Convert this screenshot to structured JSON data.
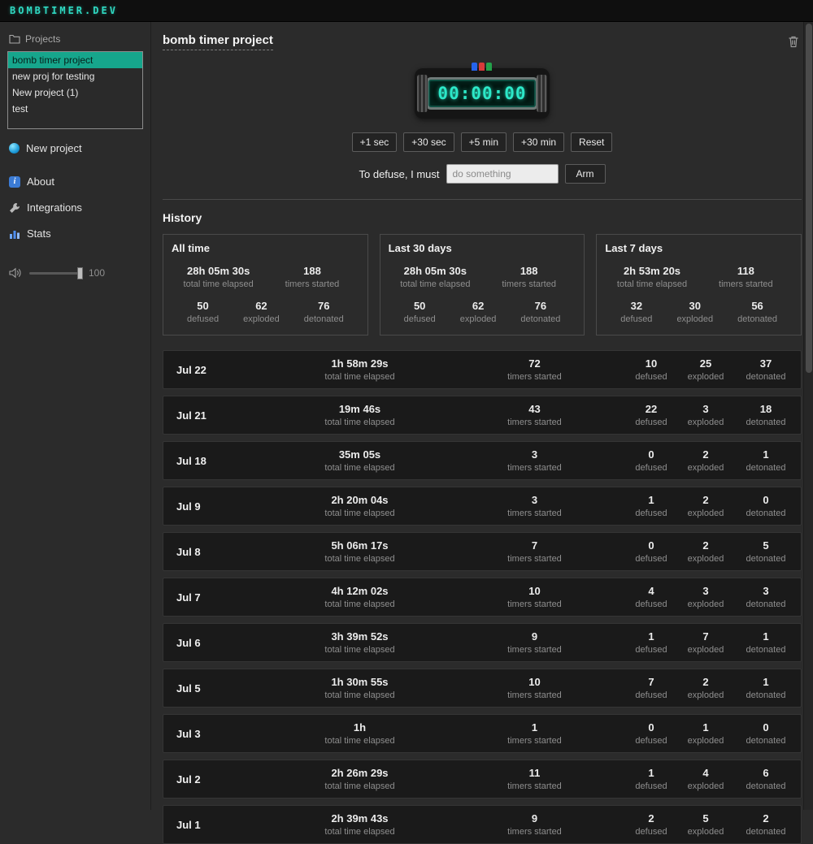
{
  "topbar": {
    "logo": "BOMBTIMER.DEV"
  },
  "sidebar": {
    "projects_label": "Projects",
    "projects": [
      {
        "name": "bomb timer project",
        "selected": true
      },
      {
        "name": "new proj for testing",
        "selected": false
      },
      {
        "name": "New project (1)",
        "selected": false
      },
      {
        "name": "test",
        "selected": false
      }
    ],
    "new_project_label": "New project",
    "about_label": "About",
    "integrations_label": "Integrations",
    "stats_label": "Stats",
    "volume_value": "100"
  },
  "main": {
    "title": "bomb timer project",
    "timer_display": "00:00:00",
    "time_buttons": [
      "+1 sec",
      "+30 sec",
      "+5 min",
      "+30 min",
      "Reset"
    ],
    "defuse_label": "To defuse, I must",
    "defuse_placeholder": "do something",
    "arm_label": "Arm",
    "history_heading": "History"
  },
  "labels": {
    "total_time_elapsed": "total time elapsed",
    "timers_started": "timers started",
    "defused": "defused",
    "exploded": "exploded",
    "detonated": "detonated"
  },
  "summaries": [
    {
      "title": "All time",
      "elapsed": "28h 05m 30s",
      "started": "188",
      "defused": "50",
      "exploded": "62",
      "detonated": "76"
    },
    {
      "title": "Last 30 days",
      "elapsed": "28h 05m 30s",
      "started": "188",
      "defused": "50",
      "exploded": "62",
      "detonated": "76"
    },
    {
      "title": "Last 7 days",
      "elapsed": "2h 53m 20s",
      "started": "118",
      "defused": "32",
      "exploded": "30",
      "detonated": "56"
    }
  ],
  "days": [
    {
      "date": "Jul 22",
      "elapsed": "1h 58m 29s",
      "started": "72",
      "defused": "10",
      "exploded": "25",
      "detonated": "37"
    },
    {
      "date": "Jul 21",
      "elapsed": "19m 46s",
      "started": "43",
      "defused": "22",
      "exploded": "3",
      "detonated": "18"
    },
    {
      "date": "Jul 18",
      "elapsed": "35m 05s",
      "started": "3",
      "defused": "0",
      "exploded": "2",
      "detonated": "1"
    },
    {
      "date": "Jul 9",
      "elapsed": "2h 20m 04s",
      "started": "3",
      "defused": "1",
      "exploded": "2",
      "detonated": "0"
    },
    {
      "date": "Jul 8",
      "elapsed": "5h 06m 17s",
      "started": "7",
      "defused": "0",
      "exploded": "2",
      "detonated": "5"
    },
    {
      "date": "Jul 7",
      "elapsed": "4h 12m 02s",
      "started": "10",
      "defused": "4",
      "exploded": "3",
      "detonated": "3"
    },
    {
      "date": "Jul 6",
      "elapsed": "3h 39m 52s",
      "started": "9",
      "defused": "1",
      "exploded": "7",
      "detonated": "1"
    },
    {
      "date": "Jul 5",
      "elapsed": "1h 30m 55s",
      "started": "10",
      "defused": "7",
      "exploded": "2",
      "detonated": "1"
    },
    {
      "date": "Jul 3",
      "elapsed": "1h",
      "started": "1",
      "defused": "0",
      "exploded": "1",
      "detonated": "0"
    },
    {
      "date": "Jul 2",
      "elapsed": "2h 26m 29s",
      "started": "11",
      "defused": "1",
      "exploded": "4",
      "detonated": "6"
    },
    {
      "date": "Jul 1",
      "elapsed": "2h 39m 43s",
      "started": "9",
      "defused": "2",
      "exploded": "5",
      "detonated": "2"
    }
  ]
}
